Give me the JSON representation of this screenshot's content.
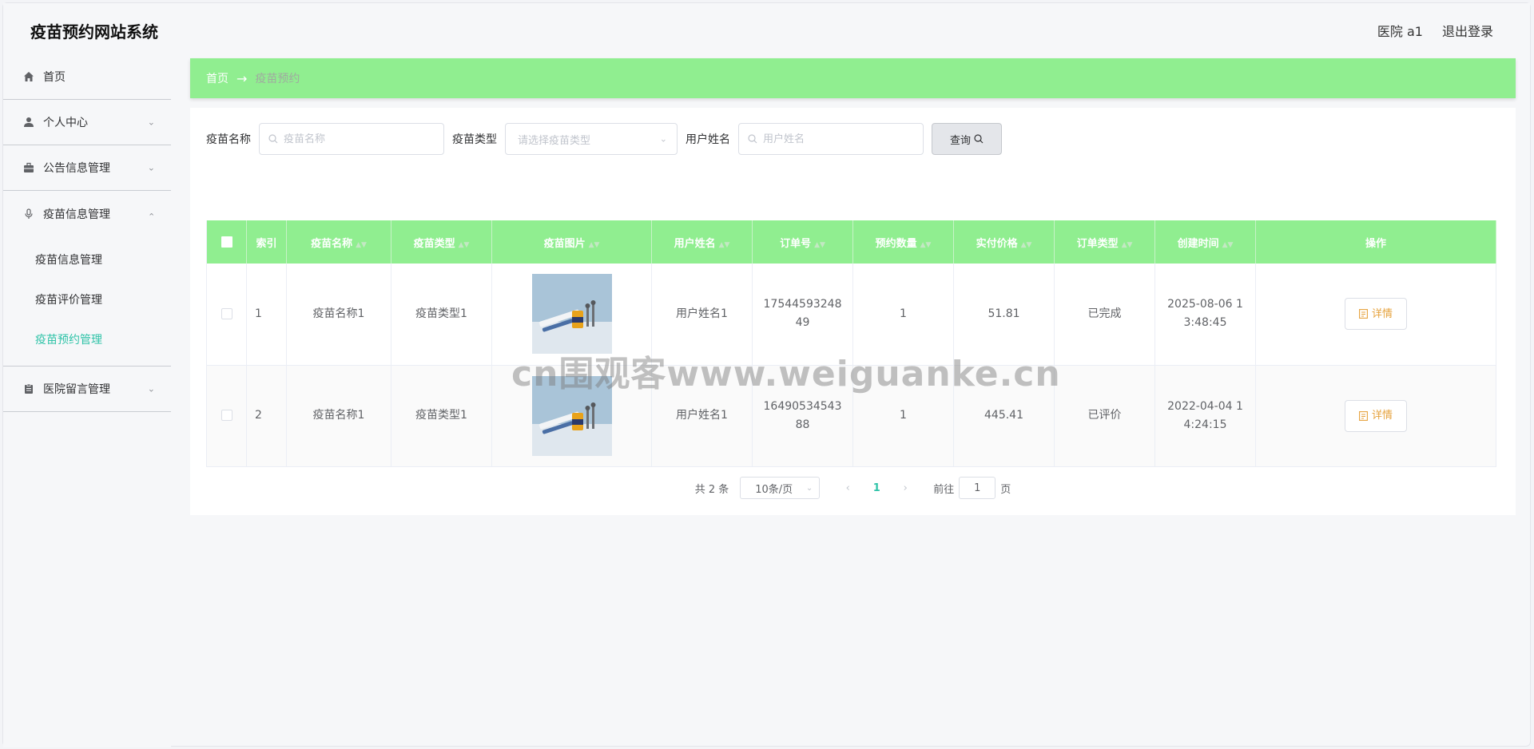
{
  "app": {
    "title": "疫苗预约网站系统"
  },
  "header": {
    "user_label": "医院 a1",
    "logout_label": "退出登录"
  },
  "sidebar": {
    "items": [
      {
        "label": "首页",
        "icon": "home-icon",
        "expanded": false
      },
      {
        "label": "个人中心",
        "icon": "user-icon",
        "expanded": false
      },
      {
        "label": "公告信息管理",
        "icon": "briefcase-icon",
        "expanded": false
      },
      {
        "label": "疫苗信息管理",
        "icon": "microphone-icon",
        "expanded": true,
        "children": [
          {
            "label": "疫苗信息管理",
            "active": false
          },
          {
            "label": "疫苗评价管理",
            "active": false
          },
          {
            "label": "疫苗预约管理",
            "active": true
          }
        ]
      },
      {
        "label": "医院留言管理",
        "icon": "clipboard-icon",
        "expanded": false
      }
    ]
  },
  "breadcrumb": {
    "home": "首页",
    "separator": "→",
    "current": "疫苗预约"
  },
  "search": {
    "vaccine_name_label": "疫苗名称",
    "vaccine_name_placeholder": "疫苗名称",
    "vaccine_type_label": "疫苗类型",
    "vaccine_type_placeholder": "请选择疫苗类型",
    "user_name_label": "用户姓名",
    "user_name_placeholder": "用户姓名",
    "query_label": "查询"
  },
  "table": {
    "columns": [
      "索引",
      "疫苗名称",
      "疫苗类型",
      "疫苗图片",
      "用户姓名",
      "订单号",
      "预约数量",
      "实付价格",
      "订单类型",
      "创建时间",
      "操作"
    ],
    "rows": [
      {
        "index": "1",
        "vaccine_name": "疫苗名称1",
        "vaccine_type": "疫苗类型1",
        "user_name": "用户姓名1",
        "order_no": "1754459324849",
        "quantity": "1",
        "price": "51.81",
        "order_type": "已完成",
        "created": "2025-08-06 13:48:45",
        "action": "详情"
      },
      {
        "index": "2",
        "vaccine_name": "疫苗名称1",
        "vaccine_type": "疫苗类型1",
        "user_name": "用户姓名1",
        "order_no": "1649053454388",
        "quantity": "1",
        "price": "445.41",
        "order_type": "已评价",
        "created": "2022-04-04 14:24:15",
        "action": "详情"
      }
    ]
  },
  "pagination": {
    "total_label": "共 2 条",
    "page_size": "10条/页",
    "current_page": "1",
    "goto_label": "前往",
    "goto_value": "1",
    "page_suffix": "页"
  },
  "watermark": "cn围观客www.weiguanke.cn",
  "colors": {
    "accent_green": "#90ee90",
    "active_teal": "#2fc3a8",
    "detail_orange": "#e6a23c"
  }
}
